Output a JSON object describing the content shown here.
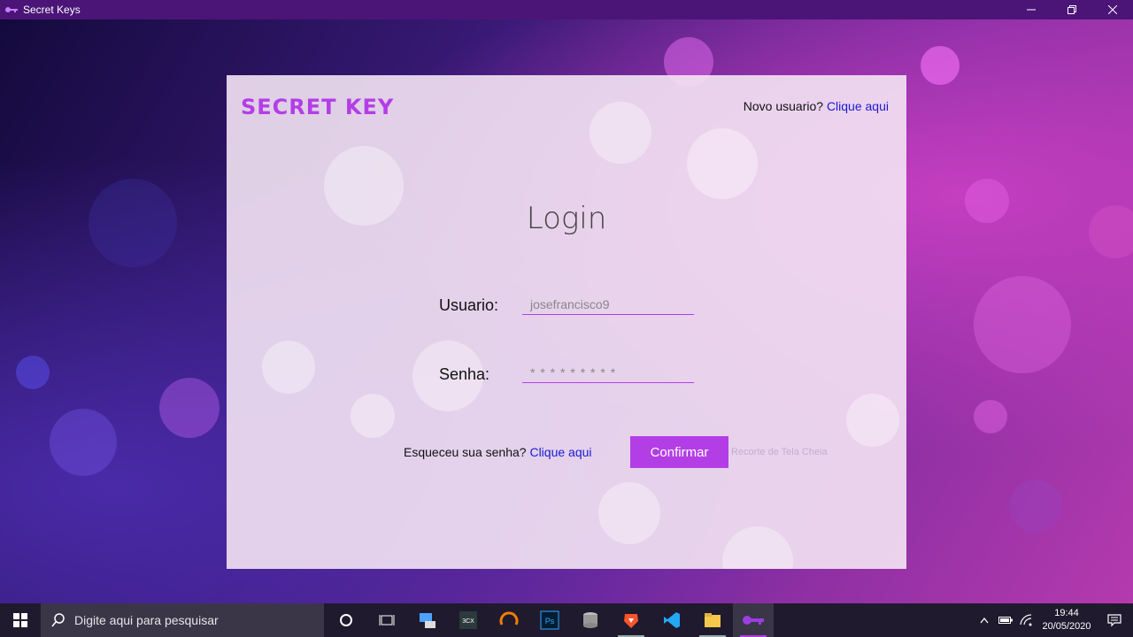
{
  "window": {
    "title": "Secret Keys",
    "minimize_icon": "minimize-icon",
    "maximize_icon": "restore-icon",
    "close_icon": "close-icon"
  },
  "card": {
    "brand": "SECRET KEY",
    "new_user_text": "Novo usuario? ",
    "new_user_link": "Clique aqui",
    "login_title": "Login",
    "username_label": "Usuario:",
    "username_value": "josefrancisco9",
    "password_label": "Senha:",
    "password_value": "* * * * * * * * *",
    "forgot_text": "Esqueceu sua senha? ",
    "forgot_link": "Clique aqui",
    "confirm_label": "Confirmar",
    "ghost_text": "Recorte de Tela Cheia"
  },
  "taskbar": {
    "search_placeholder": "Digite aqui para pesquisar",
    "time": "19:44",
    "date": "20/05/2020",
    "apps": [
      "cortana-icon",
      "task-view-icon",
      "network-pc-icon",
      "3cx-icon",
      "ubuntu-icon",
      "photoshop-icon",
      "database-icon",
      "brave-icon",
      "vscode-icon",
      "file-explorer-icon",
      "secret-keys-icon"
    ]
  },
  "colors": {
    "accent": "#b33ee6",
    "link": "#1a1ad0"
  }
}
